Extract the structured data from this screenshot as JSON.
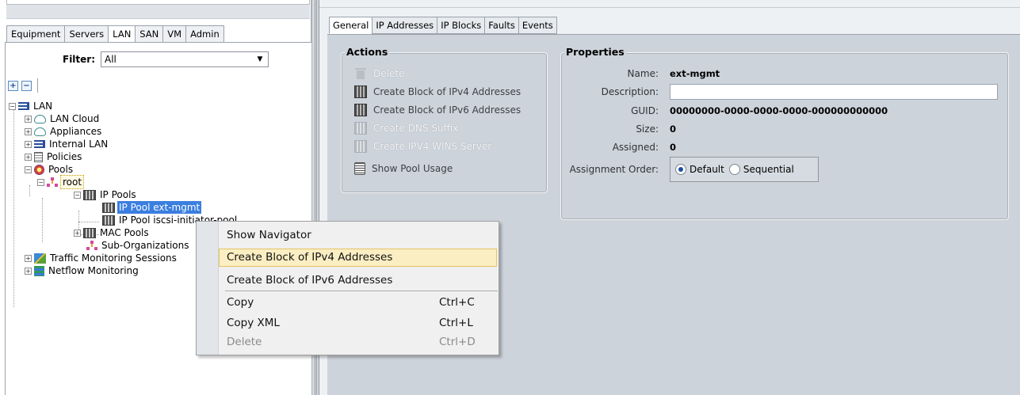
{
  "nav_tabs": [
    {
      "label": "Equipment"
    },
    {
      "label": "Servers"
    },
    {
      "label": "LAN",
      "active": true
    },
    {
      "label": "SAN"
    },
    {
      "label": "VM"
    },
    {
      "label": "Admin"
    }
  ],
  "filter": {
    "label": "Filter:",
    "value": "All"
  },
  "tree_buttons": {
    "expand_all": "+",
    "collapse_all": "−"
  },
  "tree": {
    "lan": "LAN",
    "lan_cloud": "LAN Cloud",
    "appliances": "Appliances",
    "internal_lan": "Internal LAN",
    "policies": "Policies",
    "pools": "Pools",
    "root": "root",
    "ip_pools": "IP Pools",
    "ip_pool_ext_mgmt": "IP Pool ext-mgmt",
    "ip_pool_iscsi": "IP Pool iscsi-initiator-pool",
    "mac_pools": "MAC Pools",
    "sub_orgs": "Sub-Organizations",
    "traffic_monitoring": "Traffic Monitoring Sessions",
    "netflow": "Netflow Monitoring"
  },
  "detail_tabs": [
    {
      "label": "General",
      "active": true
    },
    {
      "label": "IP Addresses"
    },
    {
      "label": "IP Blocks"
    },
    {
      "label": "Faults"
    },
    {
      "label": "Events"
    }
  ],
  "actions": {
    "title": "Actions",
    "items": [
      {
        "label": "Delete",
        "icon": "trash-icon",
        "enabled": false
      },
      {
        "label": "Create Block of IPv4 Addresses",
        "icon": "ip-block-icon",
        "enabled": true
      },
      {
        "label": "Create Block of IPv6 Addresses",
        "icon": "ip-block-icon",
        "enabled": true
      },
      {
        "label": "Create DNS Suffix",
        "icon": "ip-block-icon",
        "enabled": false
      },
      {
        "label": "Create IPV4 WINS Server",
        "icon": "ip-block-icon",
        "enabled": false
      },
      {
        "label": "Show Pool Usage",
        "icon": "pool-usage-icon",
        "enabled": true
      }
    ]
  },
  "properties": {
    "title": "Properties",
    "name_label": "Name:",
    "name_value": "ext-mgmt",
    "description_label": "Description:",
    "description_value": "",
    "guid_label": "GUID:",
    "guid_value": "00000000-0000-0000-0000-000000000000",
    "size_label": "Size:",
    "size_value": "0",
    "assigned_label": "Assigned:",
    "assigned_value": "0",
    "assignment_order_label": "Assignment Order:",
    "assignment_options": [
      "Default",
      "Sequential"
    ],
    "assignment_selected": "Default"
  },
  "context_menu": {
    "items": [
      {
        "label": "Show Navigator",
        "shortcut": ""
      },
      {
        "label": "Create Block of IPv4 Addresses",
        "shortcut": "",
        "hover": true
      },
      {
        "label": "Create Block of IPv6 Addresses",
        "shortcut": ""
      },
      {
        "label": "Copy",
        "shortcut": "Ctrl+C"
      },
      {
        "label": "Copy XML",
        "shortcut": "Ctrl+L"
      },
      {
        "label": "Delete",
        "shortcut": "Ctrl+D",
        "disabled": true
      }
    ]
  },
  "colors": {
    "selection": "#3a7ee0",
    "menu_hover": "#fbeec2",
    "panel_bg": "#cdd3da"
  }
}
